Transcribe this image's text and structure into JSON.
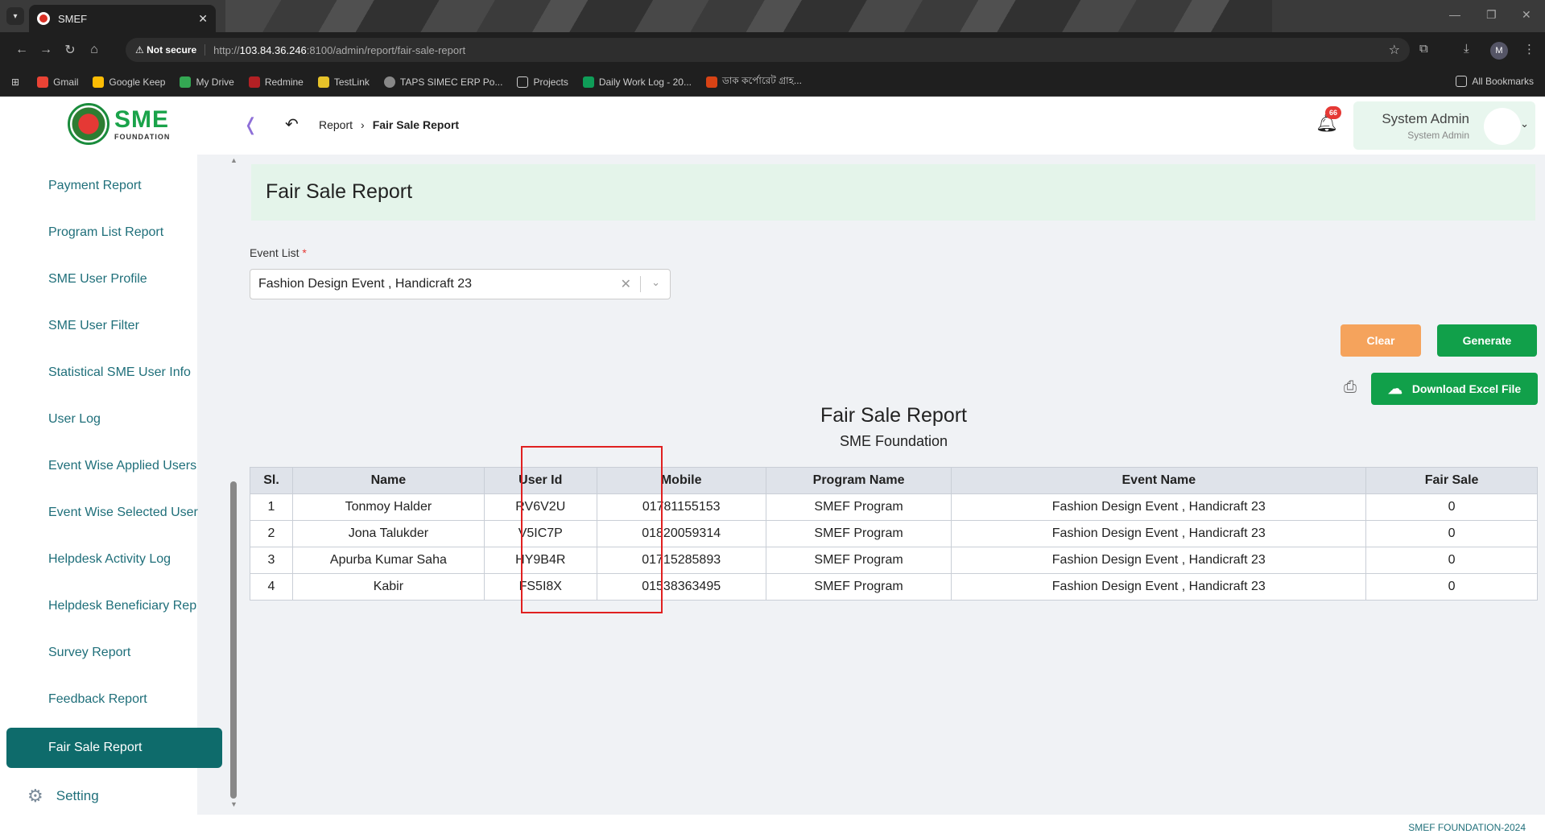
{
  "browser": {
    "tab_title": "SMEF",
    "not_secure": "Not secure",
    "url_prefix": "http://",
    "url_host": "103.84.36.246",
    "url_path": ":8100/admin/report/fair-sale-report",
    "profile_initial": "M",
    "bookmarks": [
      "Gmail",
      "Google Keep",
      "My Drive",
      "Redmine",
      "TestLink",
      "TAPS SIMEC ERP Po...",
      "Projects",
      "Daily Work Log - 20...",
      "ডাক কর্পোরেট গ্রাহ..."
    ],
    "all_bookmarks": "All Bookmarks"
  },
  "header": {
    "logo_sme": "SME",
    "logo_foundation": "FOUNDATION",
    "breadcrumb_parent": "Report",
    "breadcrumb_current": "Fair Sale Report",
    "notification_count": "66",
    "user_name": "System Admin",
    "user_role": "System Admin"
  },
  "sidebar": {
    "items": [
      "Payment Report",
      "Program List Report",
      "SME User Profile",
      "SME User Filter",
      "Statistical SME User Info",
      "User Log",
      "Event Wise Applied Users",
      "Event Wise Selected User",
      "Helpdesk Activity Log",
      "Helpdesk Beneficiary Rep",
      "Survey Report",
      "Feedback Report"
    ],
    "active": "Fair Sale Report",
    "setting": "Setting"
  },
  "main": {
    "page_title": "Fair Sale Report",
    "event_label": "Event List",
    "event_required": "*",
    "event_value": "Fashion Design Event , Handicraft 23",
    "clear_label": "Clear",
    "generate_label": "Generate",
    "excel_label": "Download Excel File",
    "report_title": "Fair Sale Report",
    "report_subtitle": "SME Foundation"
  },
  "table": {
    "headers": [
      "Sl.",
      "Name",
      "User Id",
      "Mobile",
      "Program Name",
      "Event Name",
      "Fair Sale"
    ],
    "rows": [
      [
        "1",
        "Tonmoy Halder",
        "RV6V2U",
        "01781155153",
        "SMEF Program",
        "Fashion Design Event , Handicraft 23",
        "0"
      ],
      [
        "2",
        "Jona Talukder",
        "V5IC7P",
        "01820059314",
        "SMEF Program",
        "Fashion Design Event , Handicraft 23",
        "0"
      ],
      [
        "3",
        "Apurba Kumar Saha",
        "HY9B4R",
        "01715285893",
        "SMEF Program",
        "Fashion Design Event , Handicraft 23",
        "0"
      ],
      [
        "4",
        "Kabir",
        "FS5I8X",
        "01538363495",
        "SMEF Program",
        "Fashion Design Event , Handicraft 23",
        "0"
      ]
    ]
  },
  "footer": {
    "text": "SMEF FOUNDATION-2024"
  },
  "colors": {
    "primary_teal": "#0e6b6b",
    "generate_green": "#11a04a",
    "clear_orange": "#f5a35c",
    "highlight_red": "#e02020"
  }
}
